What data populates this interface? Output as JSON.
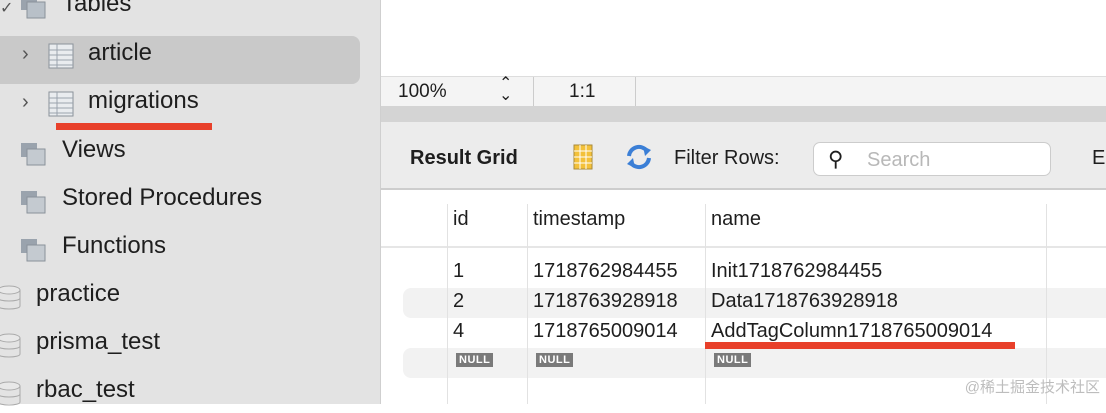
{
  "sidebar": {
    "tables_label": "Tables",
    "tables": [
      {
        "label": "article"
      },
      {
        "label": "migrations"
      }
    ],
    "groups": [
      {
        "label": "Views"
      },
      {
        "label": "Stored Procedures"
      },
      {
        "label": "Functions"
      }
    ],
    "schemas": [
      {
        "label": "practice"
      },
      {
        "label": "prisma_test"
      },
      {
        "label": "rbac_test"
      }
    ]
  },
  "zoom_bar": {
    "zoom": "100%",
    "ratio": "1:1"
  },
  "result_toolbar": {
    "title": "Result Grid",
    "filter_label": "Filter Rows:",
    "search_placeholder": "Search",
    "cut_label": "E"
  },
  "grid": {
    "columns": [
      "id",
      "timestamp",
      "name"
    ],
    "rows": [
      [
        "1",
        "1718762984455",
        "Init1718762984455"
      ],
      [
        "2",
        "1718763928918",
        "Data1718763928918"
      ],
      [
        "4",
        "1718765009014",
        "AddTagColumn1718765009014"
      ]
    ],
    "null_label": "NULL"
  },
  "watermark": "@稀土掘金技术社区",
  "colors": {
    "annotation": "#e8402a",
    "selection": "#c9c9c9"
  }
}
